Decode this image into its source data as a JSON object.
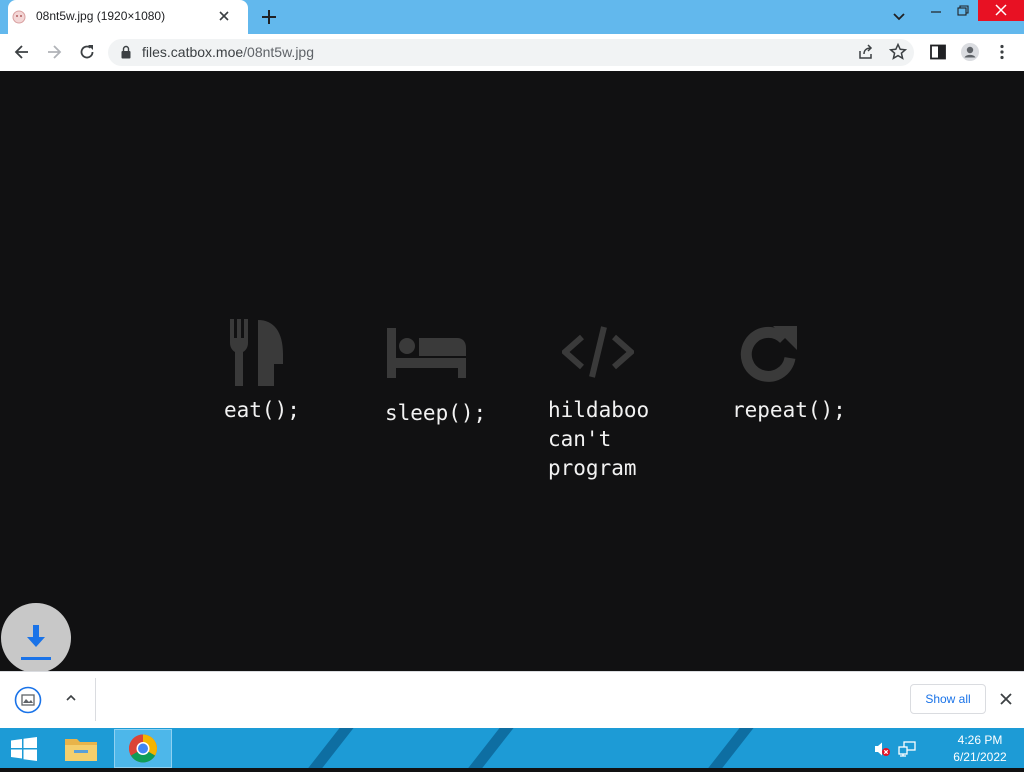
{
  "browser": {
    "tab_title": "08nt5w.jpg (1920×1080)",
    "url_host": "files.catbox.moe",
    "url_path": "/08nt5w.jpg"
  },
  "image_content": {
    "items": [
      {
        "icon": "fork-knife-icon",
        "label": "eat();"
      },
      {
        "icon": "bed-icon",
        "label": "sleep();"
      },
      {
        "icon": "code-icon",
        "label": "hildaboo\ncan't\nprogram"
      },
      {
        "icon": "repeat-icon",
        "label": "repeat();"
      }
    ]
  },
  "download_shelf": {
    "show_all_label": "Show all"
  },
  "taskbar": {
    "time": "4:26 PM",
    "date": "6/21/2022"
  },
  "colors": {
    "tab_strip": "#62b8ed",
    "content_bg": "#111112",
    "icon_gray": "#3a3a3a",
    "taskbar": "#1d9bd6",
    "link_blue": "#1a73e8",
    "close_red": "#e81123"
  }
}
